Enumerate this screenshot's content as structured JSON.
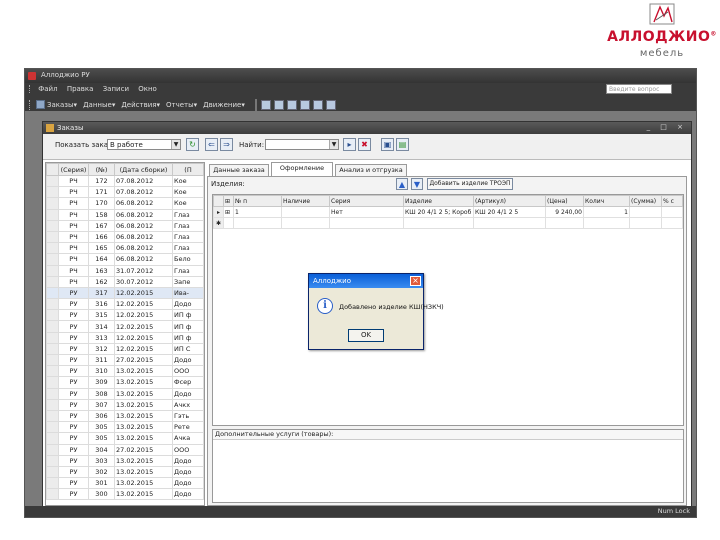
{
  "logo": {
    "name": "АЛЛОДЖИО",
    "registered": "®",
    "subtitle": "мебель"
  },
  "app": {
    "title": "Аллоджио РУ",
    "menu": [
      "Файл",
      "Правка",
      "Записи",
      "Окно"
    ],
    "help_placeholder": "Введите вопрос",
    "toolbar": [
      "Заказы",
      "Данные",
      "Действия",
      "Отчеты",
      "Движение"
    ],
    "status": "Num Lock"
  },
  "orders_window": {
    "title": "Заказы",
    "controls": "_ □ ×",
    "show_orders_label": "Показать заказы:",
    "show_orders_value": "В работе",
    "find_label": "Найти:",
    "find_value": "",
    "list_headers": [
      "(Серия)",
      "(№)",
      "(Дата сборки)",
      "(П"
    ],
    "list_rows": [
      [
        "РЧ",
        "172",
        "07.08.2012",
        "Кое"
      ],
      [
        "РЧ",
        "171",
        "07.08.2012",
        "Кое"
      ],
      [
        "РЧ",
        "170",
        "06.08.2012",
        "Кое"
      ],
      [
        "РЧ",
        "158",
        "06.08.2012",
        "Глаз"
      ],
      [
        "РЧ",
        "167",
        "06.08.2012",
        "Глаз"
      ],
      [
        "РЧ",
        "166",
        "06.08.2012",
        "Глаз"
      ],
      [
        "РЧ",
        "165",
        "06.08.2012",
        "Глаз"
      ],
      [
        "РЧ",
        "164",
        "06.08.2012",
        "Бело"
      ],
      [
        "РЧ",
        "163",
        "31.07.2012",
        "Глаз"
      ],
      [
        "РЧ",
        "162",
        "30.07.2012",
        "Запе"
      ],
      [
        "РУ",
        "317",
        "12.02.2015",
        "Ива-"
      ],
      [
        "РУ",
        "316",
        "12.02.2015",
        "Додо"
      ],
      [
        "РУ",
        "315",
        "12.02.2015",
        "ИП ф"
      ],
      [
        "РУ",
        "314",
        "12.02.2015",
        "ИП ф"
      ],
      [
        "РУ",
        "313",
        "12.02.2015",
        "ИП ф"
      ],
      [
        "РУ",
        "312",
        "12.02.2015",
        "ИП С"
      ],
      [
        "РУ",
        "311",
        "27.02.2015",
        "Додо"
      ],
      [
        "РУ",
        "310",
        "13.02.2015",
        "ООО"
      ],
      [
        "РУ",
        "309",
        "13.02.2015",
        "Фсер"
      ],
      [
        "РУ",
        "308",
        "13.02.2015",
        "Додо"
      ],
      [
        "РУ",
        "307",
        "13.02.2015",
        "Ачкх"
      ],
      [
        "РУ",
        "306",
        "13.02.2015",
        "Гэть"
      ],
      [
        "РУ",
        "305",
        "13.02.2015",
        "Рете"
      ],
      [
        "РУ",
        "305",
        "13.02.2015",
        "Ачка"
      ],
      [
        "РУ",
        "304",
        "27.02.2015",
        "ООО"
      ],
      [
        "РУ",
        "303",
        "13.02.2015",
        "Додо"
      ],
      [
        "РУ",
        "302",
        "13.02.2015",
        "Додо"
      ],
      [
        "РУ",
        "301",
        "13.02.2015",
        "Додо"
      ],
      [
        "РУ",
        "300",
        "13.02.2015",
        "Додо"
      ]
    ],
    "tabs": [
      "Данные заказа",
      "Оформление",
      "Анализ и отгрузка"
    ],
    "products_label": "Изделия:",
    "add_product_button": "Добавить изделие ТРОЭП",
    "grid_headers": [
      "№ п",
      "Наличие",
      "Серия",
      "Изделие",
      "(Артикул)",
      "(Цена)",
      "Колич",
      "(Сумма)",
      "% с"
    ],
    "grid_rows": [
      [
        "1",
        "Нет",
        "КШ 20 4/1 2 5; Короб шкаф",
        "КШ 20 4/1 2 5",
        "9 240,00",
        "1",
        "",
        ""
      ]
    ],
    "extra_services_label": "Дополнительные услуги (товары):"
  },
  "dialog": {
    "title": "Аллоджио",
    "message": "Добавлено изделие КШ(НЗКЧ)",
    "ok": "OK"
  },
  "colors": {
    "brand": "#c8102e",
    "app_chrome": "#3a3a3a",
    "dialog_title": "#0a5fd8"
  }
}
